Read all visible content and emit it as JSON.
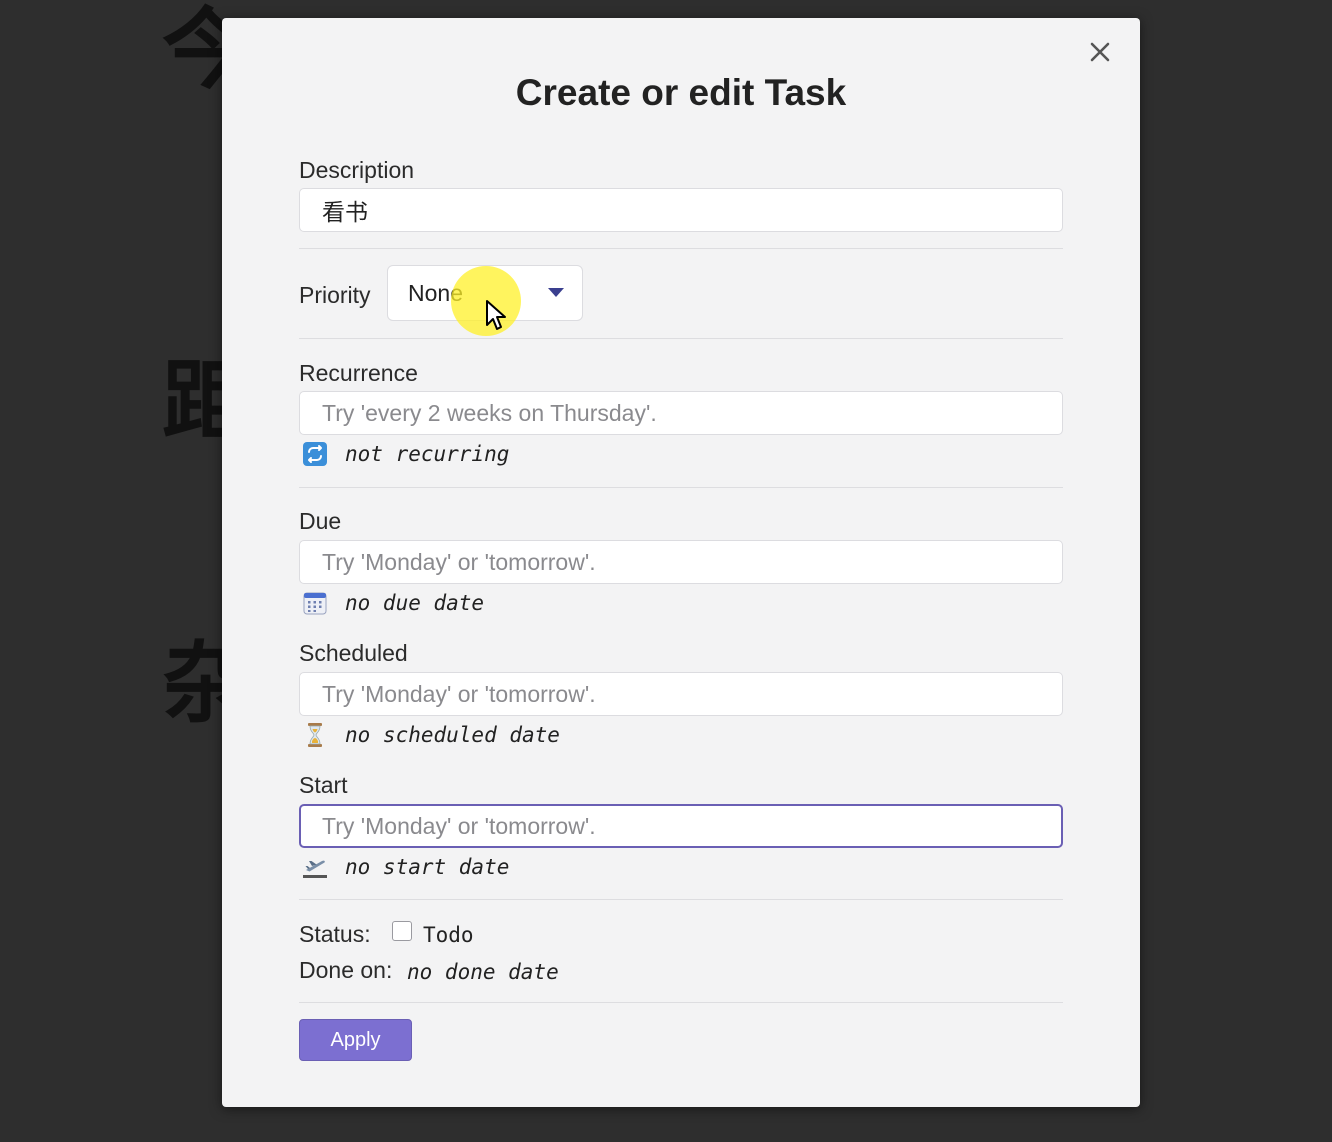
{
  "background": {
    "chars": [
      "今",
      "距",
      "杂"
    ]
  },
  "modal": {
    "title": "Create or edit Task",
    "close_icon": "close-icon"
  },
  "description": {
    "label": "Description",
    "value": "看书"
  },
  "priority": {
    "label": "Priority",
    "selected": "None"
  },
  "recurrence": {
    "label": "Recurrence",
    "placeholder": "Try 'every 2 weeks on Thursday'.",
    "hint": "not recurring",
    "icon": "repeat-icon"
  },
  "due": {
    "label": "Due",
    "placeholder": "Try 'Monday' or 'tomorrow'.",
    "hint": "no due date",
    "icon": "calendar-icon"
  },
  "scheduled": {
    "label": "Scheduled",
    "placeholder": "Try 'Monday' or 'tomorrow'.",
    "hint": "no scheduled date",
    "icon": "hourglass-icon"
  },
  "start": {
    "label": "Start",
    "placeholder": "Try 'Monday' or 'tomorrow'.",
    "hint": "no start date",
    "icon": "airplane-departure-icon"
  },
  "status": {
    "label": "Status:",
    "checkbox_label": "Todo",
    "checked": false
  },
  "done_on": {
    "label": "Done on:",
    "value": "no done date"
  },
  "apply_label": "Apply",
  "colors": {
    "accent": "#7c6fd1",
    "focus_border": "#6a5fb4",
    "modal_bg": "#f3f3f4",
    "backdrop": "#2e2e2e"
  }
}
